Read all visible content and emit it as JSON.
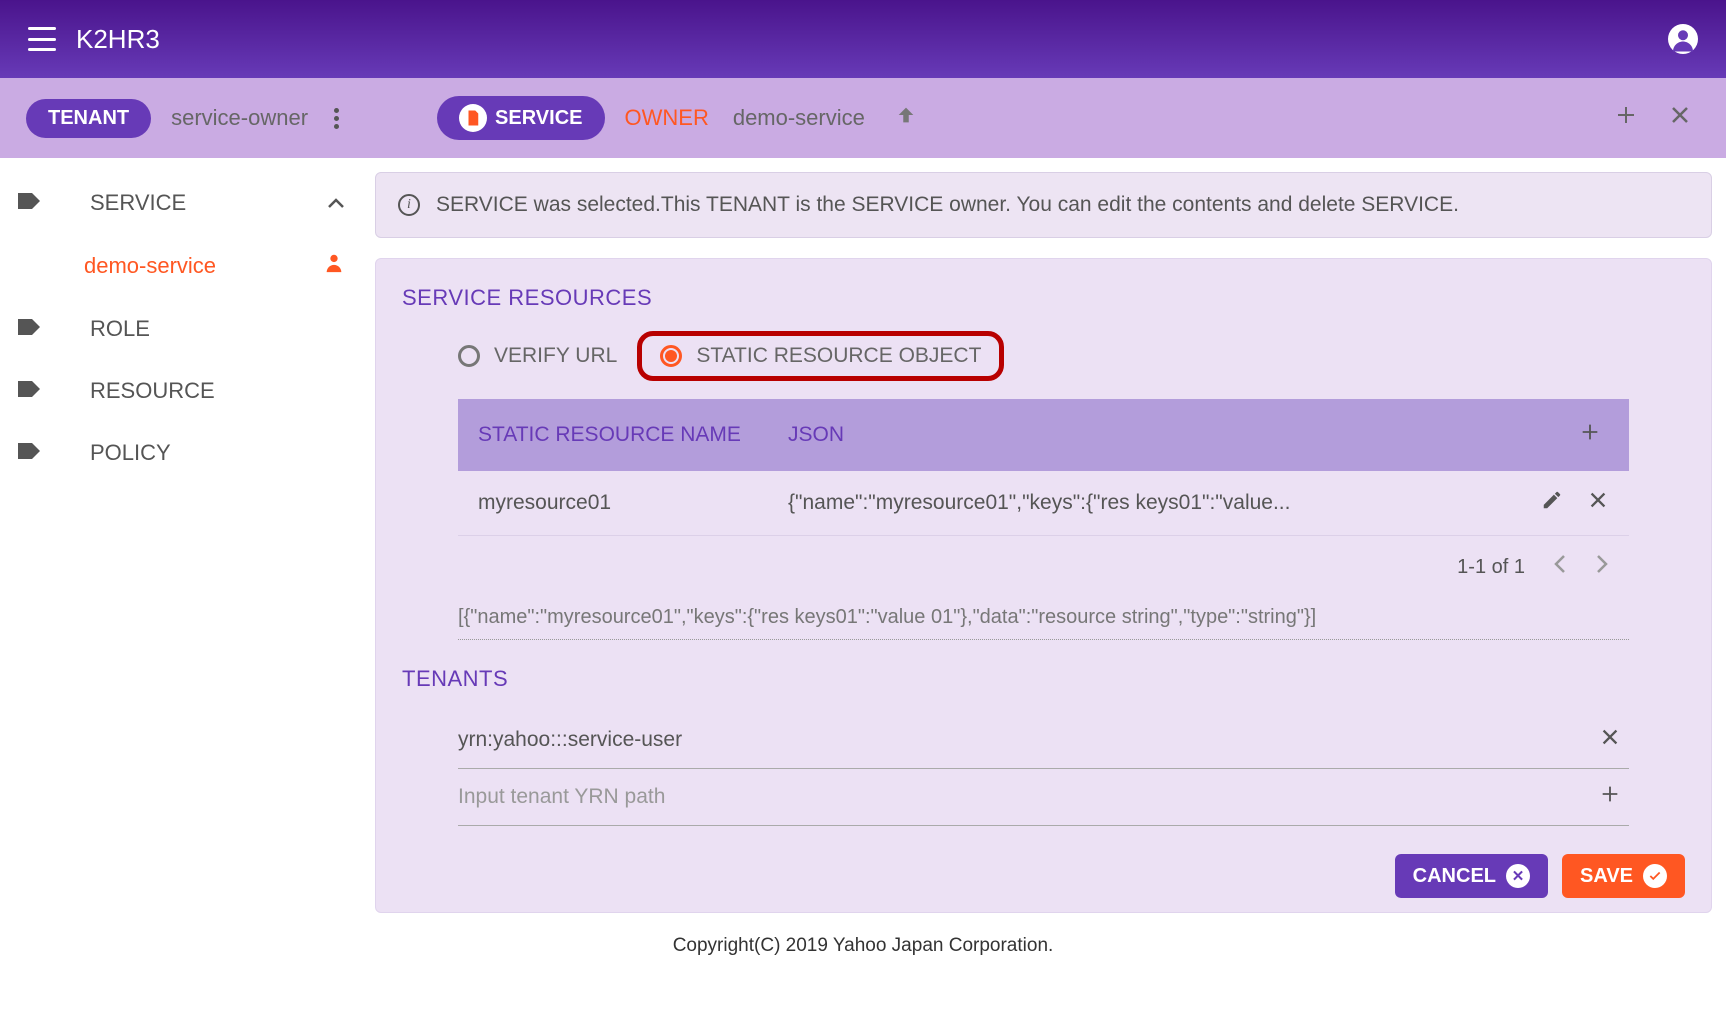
{
  "app": {
    "title": "K2HR3"
  },
  "toolbar": {
    "tenant_chip": "TENANT",
    "tenant_name": "service-owner",
    "service_chip": "SERVICE",
    "owner_label": "OWNER",
    "breadcrumb": "demo-service"
  },
  "sidebar": {
    "items": [
      "SERVICE",
      "demo-service",
      "ROLE",
      "RESOURCE",
      "POLICY"
    ]
  },
  "alert": "SERVICE was selected.This TENANT is the SERVICE owner. You can edit the contents and delete SERVICE.",
  "resources": {
    "title": "SERVICE RESOURCES",
    "radio_verify": "VERIFY URL",
    "radio_static": "STATIC RESOURCE OBJECT",
    "col_name": "STATIC RESOURCE NAME",
    "col_json": "JSON",
    "rows": [
      {
        "name": "myresource01",
        "json": "{\"name\":\"myresource01\",\"keys\":{\"res keys01\":\"value..."
      }
    ],
    "pager": "1-1 of 1",
    "json_full": "[{\"name\":\"myresource01\",\"keys\":{\"res keys01\":\"value 01\"},\"data\":\"resource string\",\"type\":\"string\"}]"
  },
  "tenants": {
    "title": "TENANTS",
    "values": [
      "yrn:yahoo:::service-user"
    ],
    "placeholder": "Input tenant YRN path"
  },
  "actions": {
    "cancel": "CANCEL",
    "save": "SAVE"
  },
  "footer": "Copyright(C) 2019 Yahoo Japan Corporation."
}
